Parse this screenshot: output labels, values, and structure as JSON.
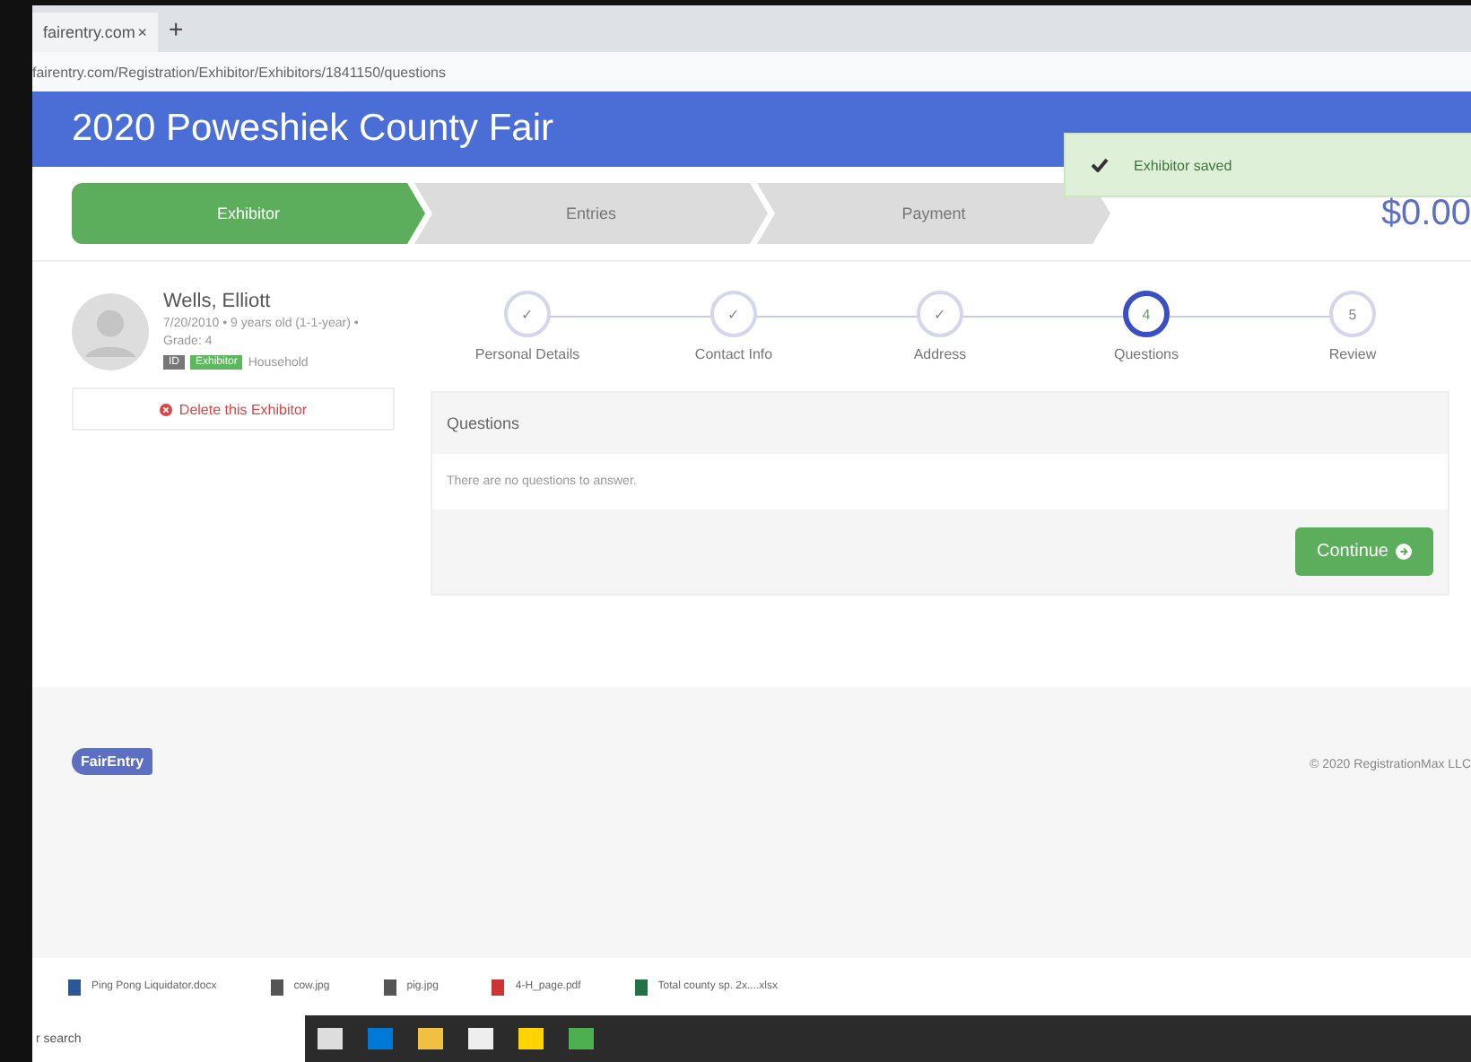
{
  "browser": {
    "tab": "fairentry.com",
    "tab_close": "×",
    "new_tab": "+",
    "url": "fairentry.com/Registration/Exhibitor/Exhibitors/1841150/questions"
  },
  "header": {
    "title": "2020 Poweshiek County Fair"
  },
  "toast": {
    "text": "Exhibitor saved"
  },
  "progress": [
    {
      "label": "Exhibitor",
      "selected": true
    },
    {
      "label": "Entries",
      "selected": false
    },
    {
      "label": "Payment",
      "selected": false
    }
  ],
  "total": "$0.00",
  "exhibitor": {
    "name": "Wells, Elliott",
    "details": "7/20/2010 • 9 years old (1-1-year) • Grade: 4",
    "badges": [
      {
        "text": "ID",
        "color": "#777777"
      },
      {
        "text": "Exhibitor",
        "color": "#5cb85c"
      }
    ],
    "badge_note": "Household",
    "delete": "Delete this Exhibitor"
  },
  "steps": [
    {
      "label": "Personal Details",
      "mark": "✓",
      "selected": false
    },
    {
      "label": "Contact Info",
      "mark": "✓",
      "selected": false
    },
    {
      "label": "Address",
      "mark": "✓",
      "selected": false
    },
    {
      "label": "Questions",
      "mark": "4",
      "selected": true
    },
    {
      "label": "Review",
      "mark": "5",
      "selected": false
    }
  ],
  "panel": {
    "title": "Questions",
    "body": "There are no questions to answer.",
    "button": "Continue"
  },
  "footer": {
    "logo": "FairEntry",
    "copyright": "© 2020 RegistrationMax LLC"
  },
  "downloads": [
    {
      "name": "Ping Pong Liquidator.docx",
      "kind": "doc"
    },
    {
      "name": "cow.jpg",
      "kind": "image"
    },
    {
      "name": "pig.jpg",
      "kind": "image"
    },
    {
      "name": "4-H_page.pdf",
      "kind": "pdf"
    },
    {
      "name": "Total county sp. 2x....xlsx",
      "kind": "sheet"
    }
  ],
  "taskbar": {
    "search": "r search"
  }
}
